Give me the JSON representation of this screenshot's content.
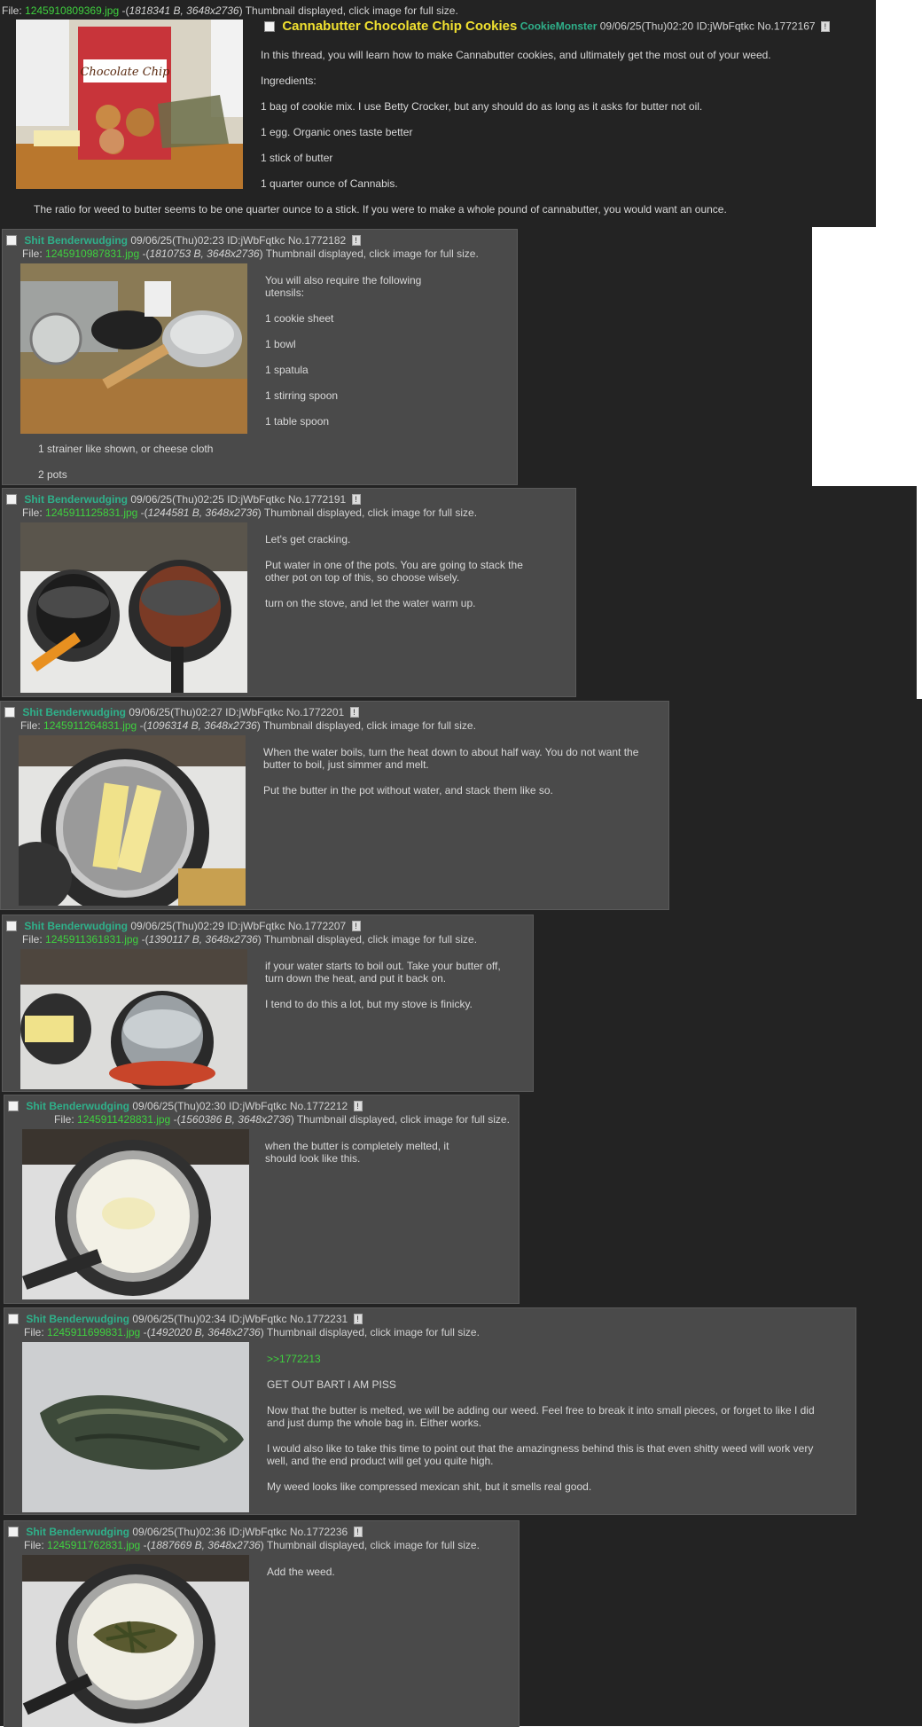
{
  "op": {
    "file_label": "File:",
    "file_name": "1245910809369.jpg",
    "file_info": "1818341 B, 3648x2736",
    "file_note": "Thumbnail displayed, click image for full size.",
    "title": "Cannabutter Chocolate Chip Cookies",
    "name": "CookieMonster",
    "date": "09/06/25(Thu)02:20",
    "id": "ID:jWbFqtkc",
    "no": "No.1772167",
    "body": [
      "In this thread, you will learn how to make Cannabutter cookies, and ultimately get the most out of your weed.",
      "Ingredients:",
      "1 bag of cookie mix. I use Betty Crocker, but any should do as long as it asks for butter not oil.",
      "1 egg. Organic ones taste better",
      "1 stick of butter",
      "1 quarter ounce of Cannabis."
    ],
    "ratio": "The ratio for weed to butter seems to be one quarter ounce to a stick. If you were to make a whole pound of cannabutter, you would want an ounce.",
    "thumb_text": "Chocolate Chip"
  },
  "replies": [
    {
      "name": "Shit Benderwudging",
      "date": "09/06/25(Thu)02:23",
      "id": "ID:jWbFqtkc",
      "no": "No.1772182",
      "file_label": "File:",
      "file_name": "1245910987831.jpg",
      "file_info": "1810753 B, 3648x2736",
      "file_note": "Thumbnail displayed, click image for full size.",
      "body": [
        "You will also require the following utensils:",
        "1 cookie sheet",
        "1 bowl",
        "1 spatula",
        "1 stirring spoon",
        "1 table spoon"
      ],
      "overflow": [
        "1 strainer like shown, or cheese cloth",
        "2 pots"
      ]
    },
    {
      "name": "Shit Benderwudging",
      "date": "09/06/25(Thu)02:25",
      "id": "ID:jWbFqtkc",
      "no": "No.1772191",
      "file_label": "File:",
      "file_name": "1245911125831.jpg",
      "file_info": "1244581 B, 3648x2736",
      "file_note": "Thumbnail displayed, click image for full size.",
      "body": [
        "Let's get cracking.",
        "Put water in one of the pots. You are going to stack the other pot on top of this, so choose wisely.",
        "turn on the stove, and let the water warm up."
      ]
    },
    {
      "name": "Shit Benderwudging",
      "date": "09/06/25(Thu)02:27",
      "id": "ID:jWbFqtkc",
      "no": "No.1772201",
      "file_label": "File:",
      "file_name": "1245911264831.jpg",
      "file_info": "1096314 B, 3648x2736",
      "file_note": "Thumbnail displayed, click image for full size.",
      "body": [
        "When the water boils, turn the heat down to about half way. You do not want the butter to boil, just simmer and melt.",
        "Put the butter in the pot without water, and stack them like so."
      ]
    },
    {
      "name": "Shit Benderwudging",
      "date": "09/06/25(Thu)02:29",
      "id": "ID:jWbFqtkc",
      "no": "No.1772207",
      "file_label": "File:",
      "file_name": "1245911361831.jpg",
      "file_info": "1390117 B, 3648x2736",
      "file_note": "Thumbnail displayed, click image for full size.",
      "body": [
        "if your water starts to boil out. Take your butter off, turn down the heat, and put it back on.",
        "I tend to do this a lot, but my stove is finicky."
      ]
    },
    {
      "name": "Shit Benderwudging",
      "date": "09/06/25(Thu)02:30",
      "id": "ID:jWbFqtkc",
      "no": "No.1772212",
      "file_label": "File:",
      "file_name": "1245911428831.jpg",
      "file_info": "1560386 B, 3648x2736",
      "file_note": "Thumbnail displayed, click image for full size.",
      "body": [
        "when the butter is completely melted, it should look like this."
      ]
    },
    {
      "name": "Shit Benderwudging",
      "date": "09/06/25(Thu)02:34",
      "id": "ID:jWbFqtkc",
      "no": "No.1772231",
      "file_label": "File:",
      "file_name": "1245911699831.jpg",
      "file_info": "1492020 B, 3648x2736",
      "file_note": "Thumbnail displayed, click image for full size.",
      "quote": ">>1772213",
      "body": [
        "GET OUT BART I AM PISS",
        "Now that the butter is melted, we will be adding our weed. Feel free to break it into small pieces, or forget to like I did and just dump the whole bag in. Either works.",
        "I would also like to take this time to point out that the amazingness behind this is that even shitty weed will work very well, and the end product will get you quite high.",
        "My weed looks like compressed mexican shit, but it smells real good."
      ]
    },
    {
      "name": "Shit Benderwudging",
      "date": "09/06/25(Thu)02:36",
      "id": "ID:jWbFqtkc",
      "no": "No.1772236",
      "file_label": "File:",
      "file_name": "1245911762831.jpg",
      "file_info": "1887669 B, 3648x2736",
      "file_note": "Thumbnail displayed, click image for full size.",
      "body": [
        "Add the weed."
      ]
    }
  ]
}
